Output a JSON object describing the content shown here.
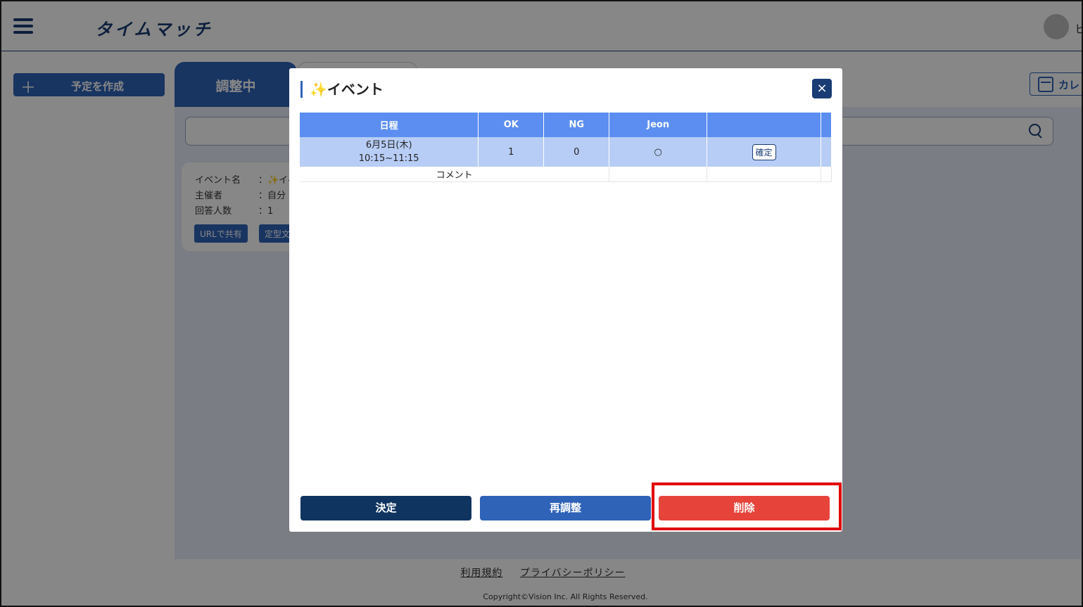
{
  "app": {
    "logo": "タイムマッチ",
    "user_initial": "ヒ"
  },
  "sidebar": {
    "create_label": "予定を作成",
    "plus": "＋"
  },
  "tabs": [
    {
      "label": "調整中"
    }
  ],
  "calendar_button": {
    "label": "カレ"
  },
  "card": {
    "event_name_key": "イベント名",
    "event_name_val": "：✨イベ",
    "organizer_key": "主催者",
    "organizer_val": "：自分",
    "respondents_key": "回答人数",
    "respondents_val": "：1",
    "share_url_label": "URLで共有",
    "template_label": "定型文"
  },
  "footer": {
    "terms": "利用規約",
    "privacy": "プライバシーポリシー",
    "copyright": "Copyright©Vision Inc. All Rights Reserved."
  },
  "modal": {
    "title": "✨イベント",
    "close": "×",
    "headers": [
      "日程",
      "OK",
      "NG",
      "Jeon",
      ""
    ],
    "row": {
      "date": "6月5日(木)",
      "time": "10:15~11:15",
      "ok": "1",
      "ng": "0",
      "jeon": "○",
      "confirm": "確定"
    },
    "comment_label": "コメント",
    "decide": "決定",
    "readjust": "再調整",
    "delete": "削除"
  }
}
